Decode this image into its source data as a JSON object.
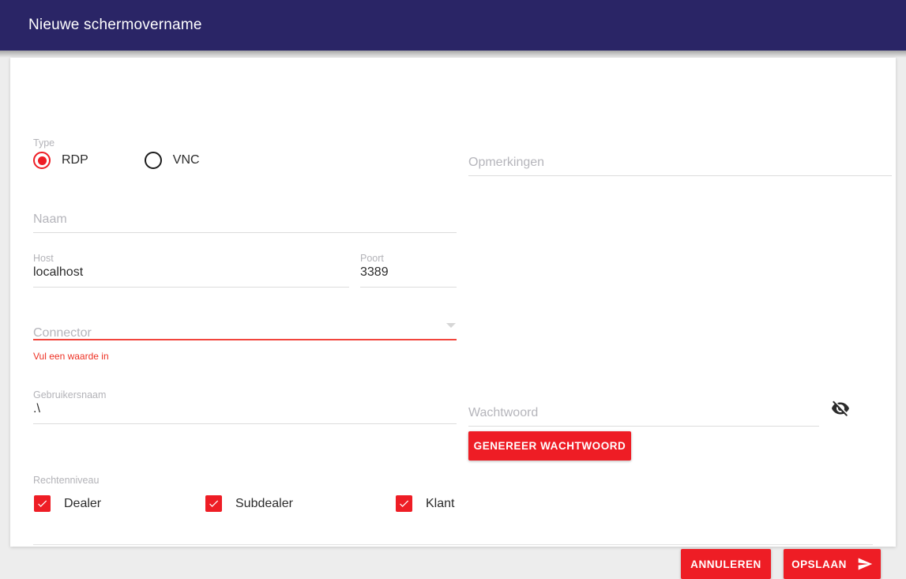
{
  "header": {
    "title": "Nieuwe schermovername",
    "bg_color": "#2a2566"
  },
  "theme": {
    "accent_red": "#ee1d25",
    "error_red": "#f2453d",
    "label_gray": "#b3b3b8"
  },
  "form": {
    "type_group": {
      "label": "Type",
      "options": [
        {
          "label": "RDP",
          "selected": true
        },
        {
          "label": "VNC",
          "selected": false
        }
      ]
    },
    "naam": {
      "label": "Naam",
      "placeholder": "Naam",
      "value": ""
    },
    "host": {
      "label": "Host",
      "value": "localhost"
    },
    "poort": {
      "label": "Poort",
      "value": "3389"
    },
    "connector": {
      "label": "Connector",
      "placeholder": "Connector",
      "value": "",
      "error": "Vul een waarde in",
      "icon": "chevron-down-icon"
    },
    "gebruikersnaam": {
      "label": "Gebruikersnaam",
      "value": ".\\"
    },
    "opmerkingen": {
      "label": "Opmerkingen",
      "placeholder": "Opmerkingen",
      "value": ""
    },
    "wachtwoord": {
      "label": "Wachtwoord",
      "placeholder": "Wachtwoord",
      "value": "",
      "toggle_icon": "eye-off-icon"
    },
    "generate_password_button": "GENEREER WACHTWOORD",
    "rechtenniveau": {
      "label": "Rechtenniveau",
      "options": [
        {
          "label": "Dealer",
          "checked": true
        },
        {
          "label": "Subdealer",
          "checked": true
        },
        {
          "label": "Klant",
          "checked": true
        }
      ]
    }
  },
  "footer": {
    "cancel_label": "ANNULEREN",
    "save_label": "OPSLAAN",
    "save_icon": "send-icon"
  }
}
